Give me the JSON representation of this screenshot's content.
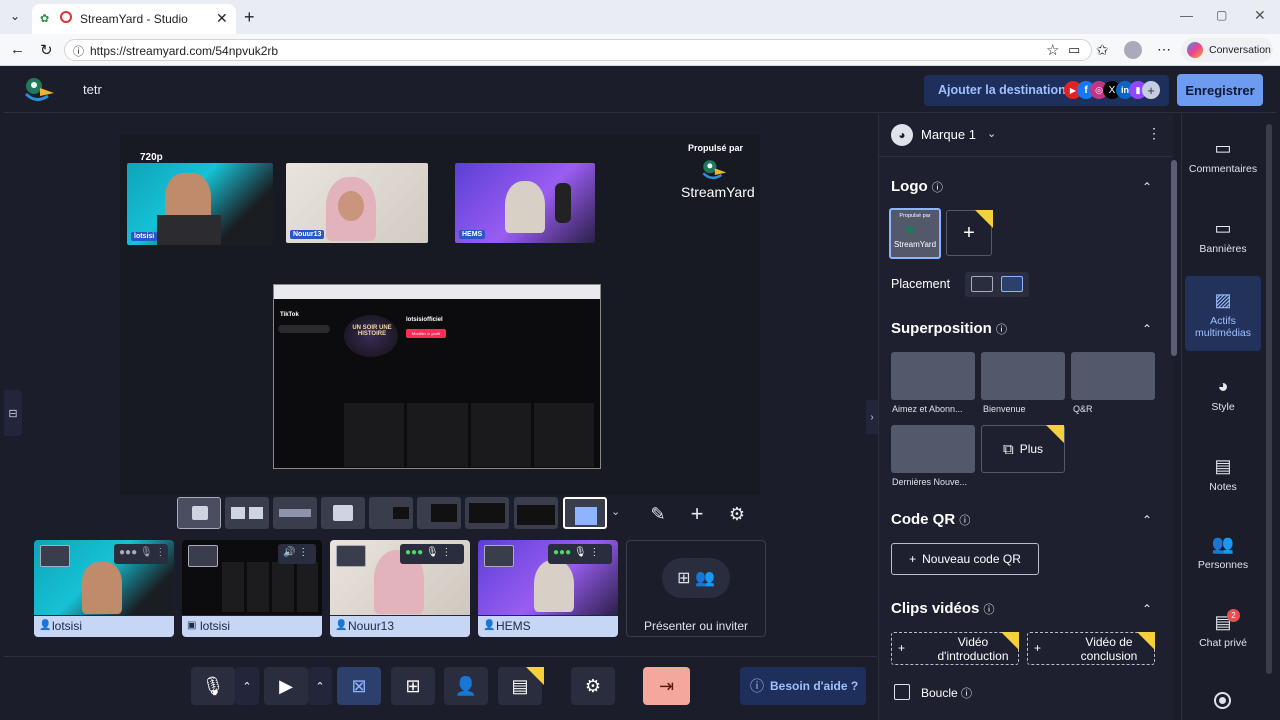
{
  "browser": {
    "tab_title": "StreamYard - Studio",
    "new_tab": "+",
    "url": "https://streamyard.com/54npvuk2rb",
    "conversation": "Conversation"
  },
  "app": {
    "studio_name": "tetr",
    "add_destination": "Ajouter la destination",
    "record": "Enregistrer",
    "resolution": "720p",
    "powered_by": "Propulsé par",
    "streamyard": "StreamYard"
  },
  "stage": {
    "cams": [
      {
        "name": "lotsisi"
      },
      {
        "name": "Nouur13"
      },
      {
        "name": "HEMS"
      }
    ],
    "screen_share": {
      "profile_name": "lotsisiofficiel",
      "logo_text": "UN SOIR UNE HISTOIRE",
      "tiktok": "TikTok",
      "edit_btn": "Modifier le profil"
    }
  },
  "participants": [
    {
      "label": "lotsisi",
      "icon": "person-icon"
    },
    {
      "label": "lotsisi",
      "icon": "screen-icon"
    },
    {
      "label": "Nouur13",
      "icon": "person-icon"
    },
    {
      "label": "HEMS",
      "icon": "person-icon"
    }
  ],
  "present_invite": "Présenter ou inviter",
  "help": "Besoin d'aide ?",
  "panel": {
    "brand": "Marque 1",
    "logo_title": "Logo",
    "logo_thumb_top": "Propulsé par",
    "logo_thumb_name": "StreamYard",
    "placement": "Placement",
    "overlay_title": "Superposition",
    "overlays": [
      "Aimez et Abonn...",
      "Bienvenue",
      "Q&R",
      "Dernières Nouve..."
    ],
    "more": "Plus",
    "qr_title": "Code QR",
    "new_qr": "Nouveau code QR",
    "clips_title": "Clips vidéos",
    "intro": "Vidéo d'introduction",
    "outro": "Vidéo de conclusion",
    "loop": "Boucle"
  },
  "rail": [
    {
      "label": "Commentaires",
      "icon": "comment-icon"
    },
    {
      "label": "Bannières",
      "icon": "banner-icon"
    },
    {
      "label": "Actifs multimédias",
      "icon": "media-icon"
    },
    {
      "label": "Style",
      "icon": "palette-icon"
    },
    {
      "label": "Notes",
      "icon": "notes-icon"
    },
    {
      "label": "Personnes",
      "icon": "people-icon"
    },
    {
      "label": "Chat privé",
      "icon": "chat-icon",
      "badge": "2"
    }
  ],
  "colors": {
    "accent": "#6d9bf1",
    "bg": "#1b1d2a",
    "star": "#f5cf3d"
  }
}
